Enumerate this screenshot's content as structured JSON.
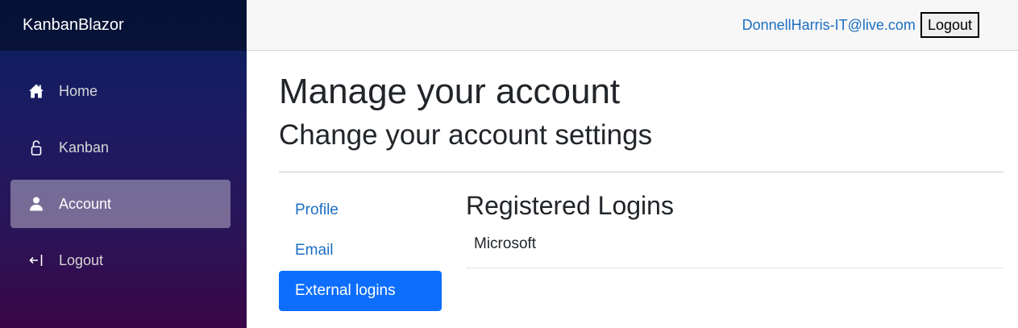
{
  "app": {
    "brand": "KanbanBlazor"
  },
  "sidebar": {
    "items": [
      {
        "label": "Home",
        "icon": "home-icon",
        "active": false
      },
      {
        "label": "Kanban",
        "icon": "lock-icon",
        "active": false
      },
      {
        "label": "Account",
        "icon": "person-icon",
        "active": true
      },
      {
        "label": "Logout",
        "icon": "logout-icon",
        "active": false
      }
    ]
  },
  "header": {
    "user_email": "DonnellHarris-IT@live.com",
    "logout_label": "Logout"
  },
  "page": {
    "title": "Manage your account",
    "subtitle": "Change your account settings"
  },
  "account_nav": {
    "items": [
      {
        "label": "Profile",
        "active": false
      },
      {
        "label": "Email",
        "active": false
      },
      {
        "label": "External logins",
        "active": true
      }
    ]
  },
  "registered_logins": {
    "title": "Registered Logins",
    "providers": [
      "Microsoft"
    ]
  },
  "colors": {
    "link": "#1b6ec2",
    "active_tab": "#0d6efd",
    "sidebar_top": "#06205a",
    "sidebar_bottom": "#3a0647"
  }
}
